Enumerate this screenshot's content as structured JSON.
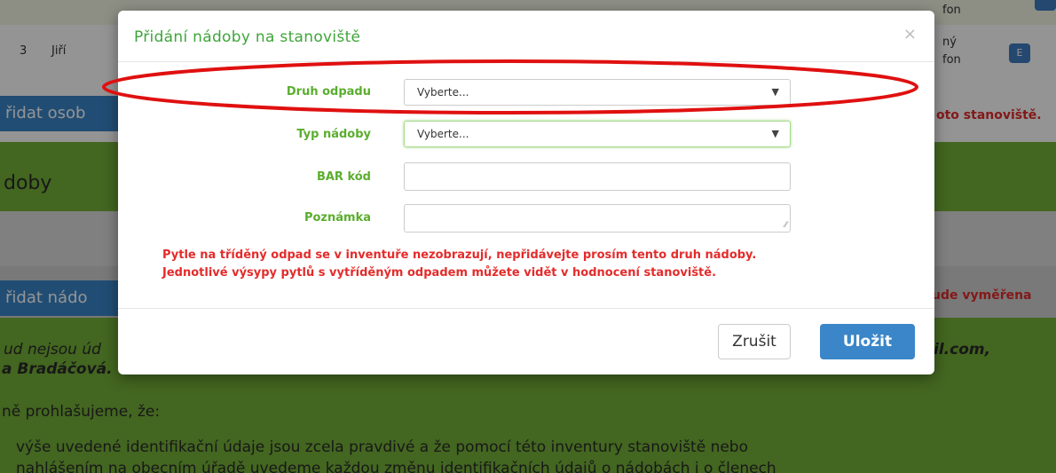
{
  "background": {
    "top_phone": "fon",
    "row": {
      "number": "3",
      "name": "Jiří",
      "contact_line1": "ný",
      "contact_line2": "fon",
      "badge": "E"
    },
    "add_person_button": "řidat osob",
    "add_container_button": "řidat nádo",
    "notice_top": "oto stanoviště.",
    "notice_bottom": "ude vyměřena",
    "section_title": "doby",
    "text_line1_left": "ud nejsou úd",
    "text_line1_right": "il.com,",
    "text_line2": "a Bradáčová.",
    "text_line3": "ně prohlašujeme, že:",
    "text_line4": "výše uvedené identifikační údaje jsou zcela pravdivé a že pomocí této inventury stanoviště nebo",
    "text_line5": "nahlášením na obecním úřadě uvedeme každou změnu identifikačních údajů o nádobách i o členech"
  },
  "modal": {
    "title": "Přidání nádoby na stanoviště",
    "close_icon": "×",
    "fields": {
      "waste_type_label": "Druh odpadu",
      "waste_type_value": "Vyberte...",
      "container_type_label": "Typ nádoby",
      "container_type_value": "Vyberte...",
      "barcode_label": "BAR kód",
      "barcode_value": "",
      "note_label": "Poznámka",
      "note_value": ""
    },
    "warning_line1": "Pytle na tříděný odpad se v inventuře nezobrazují, nepřidávejte prosím tento druh nádoby.",
    "warning_line2": "Jednotlivé výsypy pytlů s vytříděným odpadem můžete vidět v hodnocení stanoviště.",
    "cancel_button": "Zrušit",
    "save_button": "Uložit"
  },
  "colors": {
    "accent_green": "#5aae2e",
    "primary_blue": "#3a86c8",
    "warning_red": "#e42b2b",
    "highlight_ellipse": "#e01010"
  }
}
